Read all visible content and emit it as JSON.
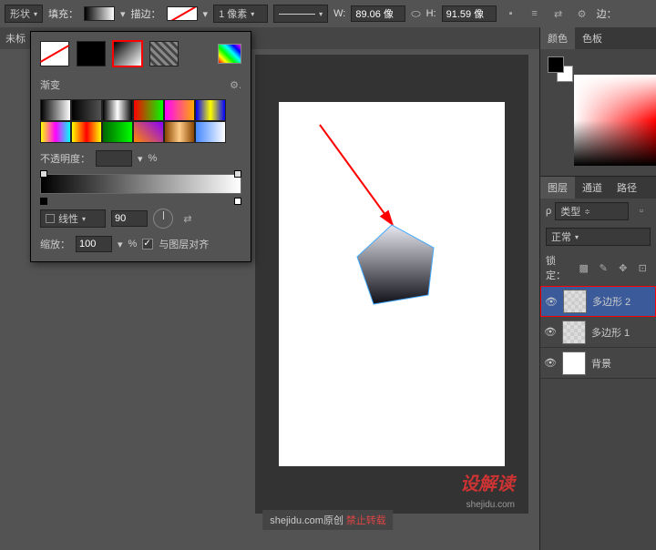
{
  "toolbar": {
    "shape_mode": "形状",
    "fill_label": "填充：",
    "stroke_label": "描边：",
    "stroke_width": "1 像素",
    "w_label": "W:",
    "w_value": "89.06 像",
    "h_label": "H:",
    "h_value": "91.59 像",
    "edges_label": "边："
  },
  "tabs": {
    "untitled": "未标"
  },
  "gradient_panel": {
    "title": "渐变",
    "opacity_label": "不透明度：",
    "opacity_unit": "%",
    "style_label": "线性",
    "angle_value": "90",
    "scale_label": "缩放：",
    "scale_value": "100",
    "scale_unit": "%",
    "align_label": "与图层对齐"
  },
  "color_panel": {
    "tab_color": "颜色",
    "tab_swatches": "色板"
  },
  "layers_panel": {
    "tab_layers": "图层",
    "tab_channels": "通道",
    "tab_paths": "路径",
    "kind_label": "类型",
    "blend_mode": "正常",
    "lock_label": "锁定：",
    "layers": [
      {
        "name": "多边形 2",
        "selected": true
      },
      {
        "name": "多边形 1",
        "selected": false
      },
      {
        "name": "背景",
        "selected": false
      }
    ]
  },
  "search_icon": "ρ",
  "watermark": {
    "brand": "设解读",
    "url": "shejidu.com",
    "credit_text": "shejidu.com原创",
    "credit_ban": "禁止转载"
  }
}
